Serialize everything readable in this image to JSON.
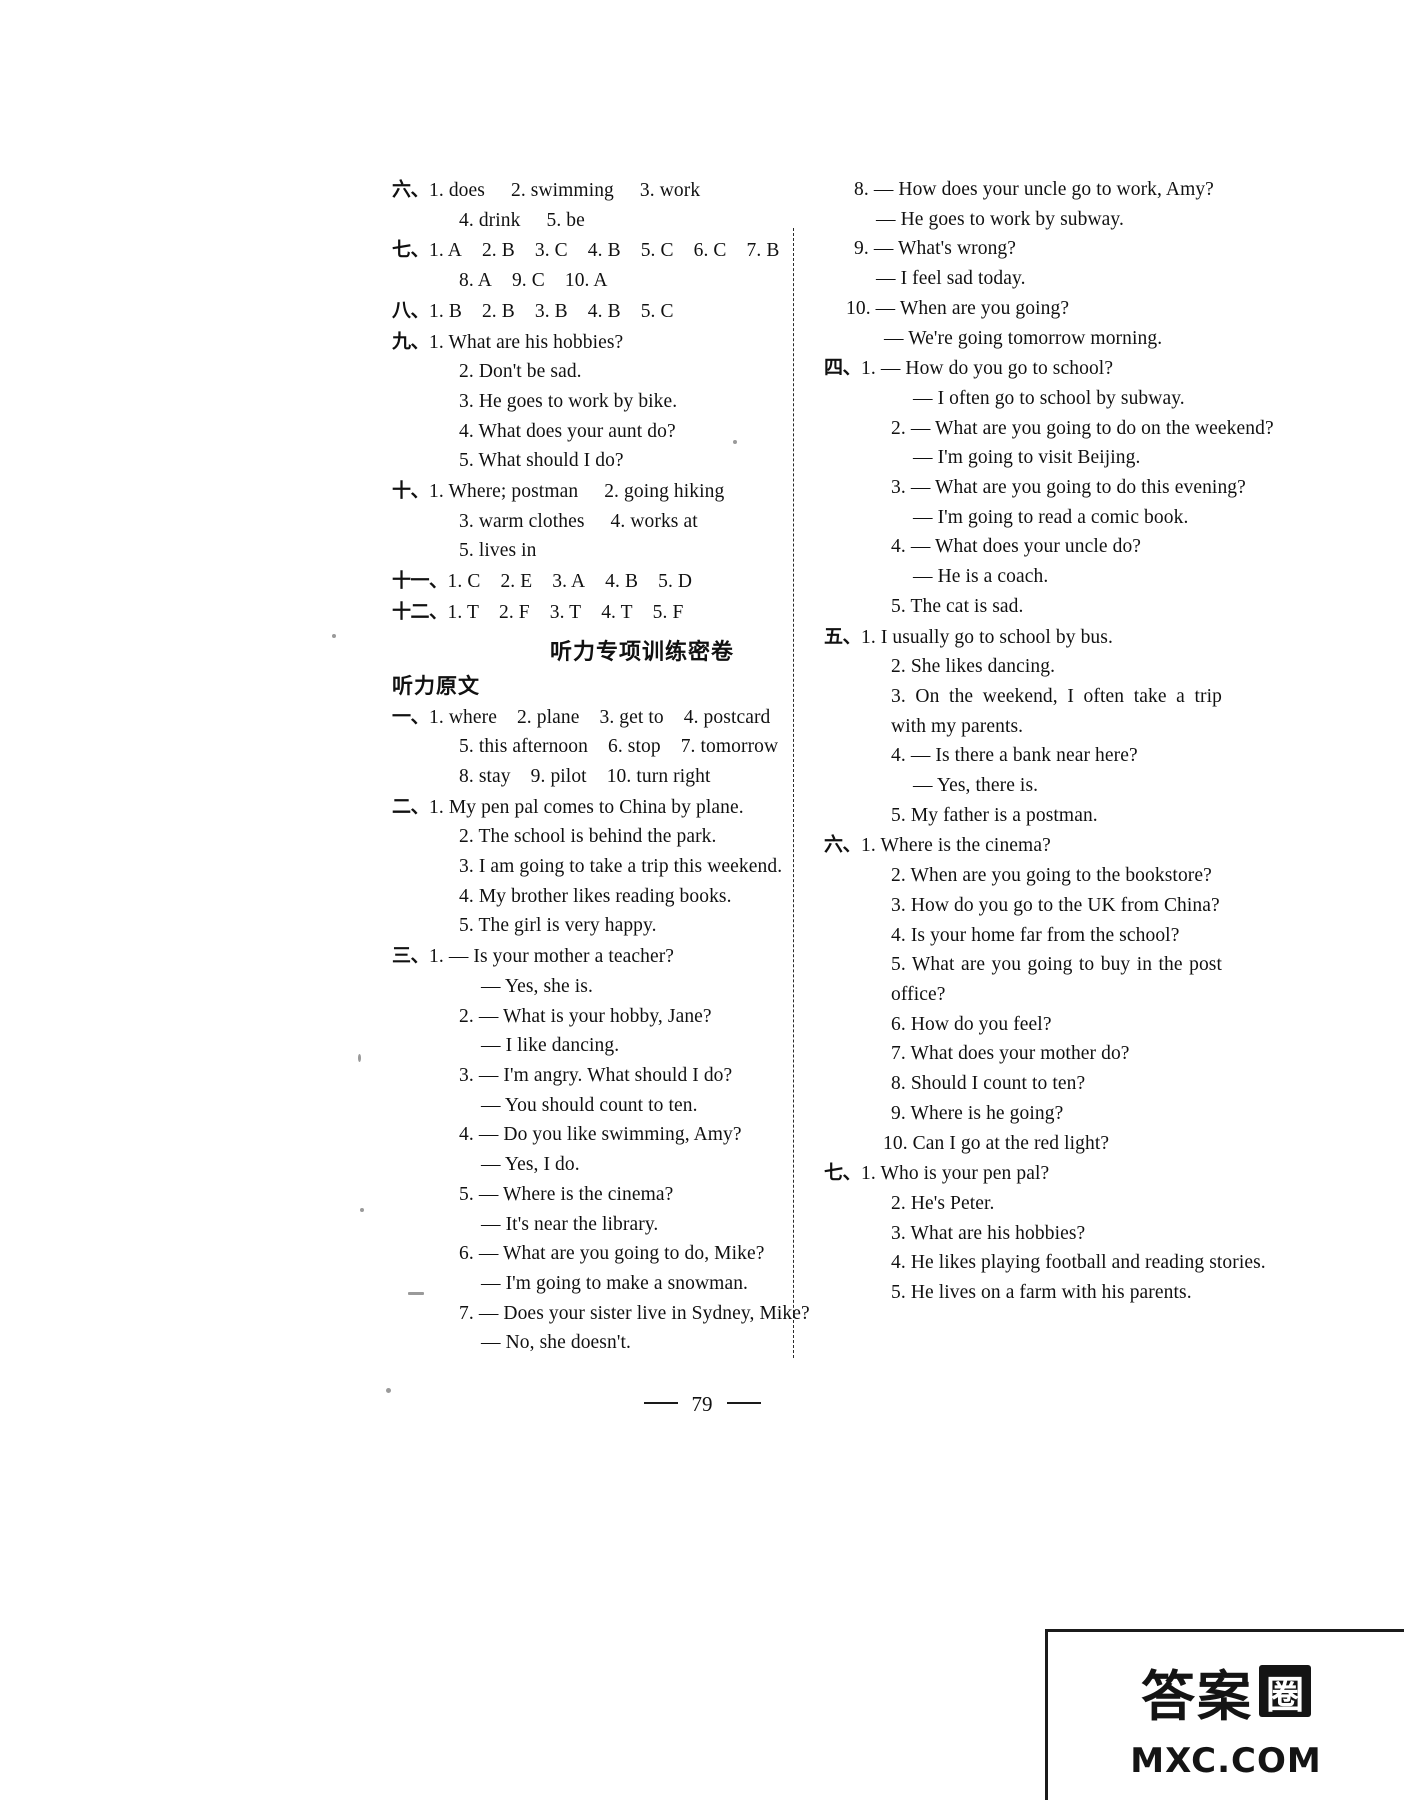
{
  "page": {
    "number": "79",
    "watermark": {
      "cn": "答案",
      "box": "圈",
      "url": "MXC.COM"
    }
  },
  "left_column": {
    "answer_sections": [
      {
        "label": "六、",
        "lines": [
          [
            "1. does",
            "2. swimming",
            "3. work"
          ],
          [
            "4. drink",
            "5. be"
          ]
        ]
      },
      {
        "label": "七、",
        "lines": [
          [
            "1. A",
            "2. B",
            "3. C",
            "4. B",
            "5. C",
            "6. C",
            "7. B"
          ],
          [
            "8. A",
            "9. C",
            "10. A"
          ]
        ]
      },
      {
        "label": "八、",
        "lines": [
          [
            "1. B",
            "2. B",
            "3. B",
            "4. B",
            "5. C"
          ]
        ]
      },
      {
        "label": "九、",
        "items": [
          "1. What are his hobbies?",
          "2. Don't be sad.",
          "3. He goes to work by bike.",
          "4. What does your aunt do?",
          "5. What should I do?"
        ]
      },
      {
        "label": "十、",
        "lines": [
          [
            "1. Where; postman",
            "2. going hiking"
          ],
          [
            "3. warm clothes",
            "4. works at"
          ],
          [
            "5. lives in"
          ]
        ]
      },
      {
        "label": "十一、",
        "lines": [
          [
            "1. C",
            "2. E",
            "3. A",
            "4. B",
            "5. D"
          ]
        ]
      },
      {
        "label": "十二、",
        "lines": [
          [
            "1. T",
            "2. F",
            "3. T",
            "4. T",
            "5. F"
          ]
        ]
      }
    ],
    "paper_title": "听力专项训练密卷",
    "script_heading": "听力原文",
    "script_sections": [
      {
        "label": "一、",
        "lines": [
          [
            "1. where",
            "2. plane",
            "3. get to",
            "4. postcard"
          ],
          [
            "5. this afternoon",
            "6. stop",
            "7. tomorrow"
          ],
          [
            "8. stay",
            "9. pilot",
            "10. turn right"
          ]
        ]
      },
      {
        "label": "二、",
        "items": [
          "1. My pen pal comes to China by plane.",
          "2. The school is behind the park.",
          "3. I am going to take a trip this weekend.",
          "4. My brother likes reading books.",
          "5. The girl is very happy."
        ]
      },
      {
        "label": "三、",
        "dialogs": [
          {
            "num": "1.",
            "q": "— Is your mother a teacher?",
            "a": "— Yes, she is."
          },
          {
            "num": "2.",
            "q": "— What is your hobby, Jane?",
            "a": "— I like dancing."
          },
          {
            "num": "3.",
            "q": "— I'm angry. What should I do?",
            "a": "— You should count to ten."
          },
          {
            "num": "4.",
            "q": "— Do you like swimming, Amy?",
            "a": "— Yes, I do."
          },
          {
            "num": "5.",
            "q": "— Where is the cinema?",
            "a": "— It's near the library."
          },
          {
            "num": "6.",
            "q": "— What are you going to do, Mike?",
            "a": "— I'm going to make a snowman."
          },
          {
            "num": "7.",
            "q": "— Does your sister live in Sydney, Mike?",
            "a": "— No, she doesn't."
          }
        ]
      }
    ]
  },
  "right_column": {
    "section_three_continued": [
      {
        "num": "8.",
        "q": "— How does your uncle go to work, Amy?",
        "a": "— He goes to work by subway."
      },
      {
        "num": "9.",
        "q": "— What's wrong?",
        "a": "— I feel sad today."
      },
      {
        "num": "10.",
        "q": "— When are you going?",
        "a": "— We're going tomorrow morning."
      }
    ],
    "sections": [
      {
        "label": "四、",
        "dialogs": [
          {
            "num": "1.",
            "q": "— How do you go to school?",
            "a": "— I often go to school by subway."
          },
          {
            "num": "2.",
            "q": "— What are you going to do on the weekend?",
            "a": "— I'm going to visit Beijing."
          },
          {
            "num": "3.",
            "q": "— What are you going to do this evening?",
            "a": "— I'm going to read a comic book."
          },
          {
            "num": "4.",
            "q": "— What does your uncle do?",
            "a": "— He is a coach."
          }
        ],
        "plain": [
          "5. The cat is sad."
        ]
      },
      {
        "label": "五、",
        "items": [
          "1. I usually go to school by bus.",
          "2. She likes dancing.",
          "3. On the weekend, I often take a trip with my parents."
        ],
        "dialogs": [
          {
            "num": "4.",
            "q": "— Is there a bank near here?",
            "a": "— Yes, there is."
          }
        ],
        "plain": [
          "5. My father is a postman."
        ]
      },
      {
        "label": "六、",
        "items": [
          "1. Where is the cinema?",
          "2. When are you going to the bookstore?",
          "3. How do you go to the UK from China?",
          "4. Is your home far from the school?",
          "5. What are you going to buy in the post office?",
          "6. How do you feel?",
          "7. What does your mother do?",
          "8. Should I count to ten?",
          "9. Where is he going?",
          "10. Can I go at the red light?"
        ]
      },
      {
        "label": "七、",
        "items": [
          "1. Who is your pen pal?",
          "2. He's Peter.",
          "3. What are his hobbies?",
          "4. He likes playing football and reading stories.",
          "5. He lives on a farm with his parents."
        ]
      }
    ]
  }
}
